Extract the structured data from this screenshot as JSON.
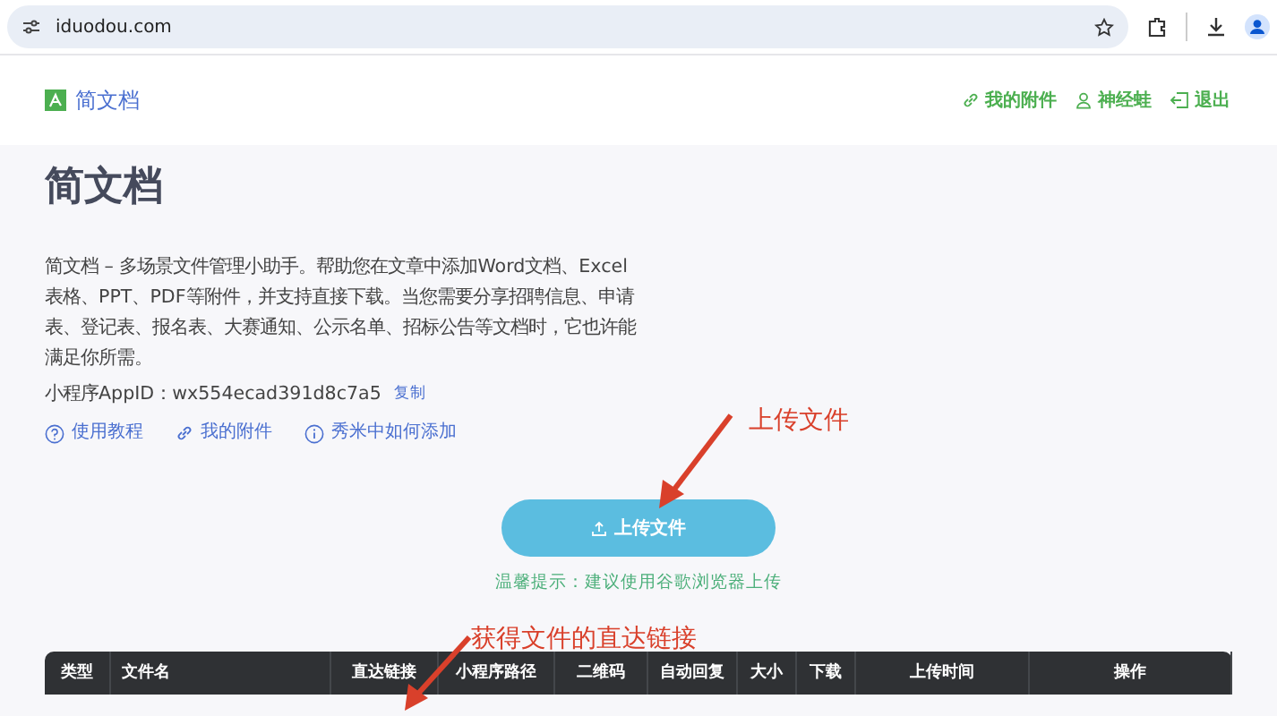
{
  "browser": {
    "url": "iduodou.com"
  },
  "header": {
    "brand": "简文档",
    "nav": [
      {
        "kind": "link",
        "label": "我的附件"
      },
      {
        "kind": "user",
        "label": "神经蛙"
      },
      {
        "kind": "logout",
        "label": "退出"
      }
    ]
  },
  "intro": {
    "title": "简文档",
    "description": "简文档 – 多场景文件管理小助手。帮助您在文章中添加Word文档、Excel表格、PPT、PDF等附件，并支持直接下载。当您需要分享招聘信息、申请表、登记表、报名表、大赛通知、公示名单、招标公告等文档时，它也许能满足你所需。",
    "appid": "小程序AppID：wx554ecad391d8c7a5",
    "copy": "复制",
    "links": [
      {
        "kind": "help",
        "label": "使用教程"
      },
      {
        "kind": "link",
        "label": "我的附件"
      },
      {
        "kind": "info",
        "label": "秀米中如何添加"
      }
    ]
  },
  "upload": {
    "button": "上传文件",
    "hint": "温馨提示：建议使用谷歌浏览器上传"
  },
  "table": {
    "columns": [
      "类型",
      "文件名",
      "直达链接",
      "小程序路径",
      "二维码",
      "自动回复",
      "大小",
      "下载",
      "上传时间",
      "操作"
    ]
  },
  "annotations": [
    {
      "text": "上传文件"
    },
    {
      "text": "获得文件的直达链接"
    }
  ]
}
